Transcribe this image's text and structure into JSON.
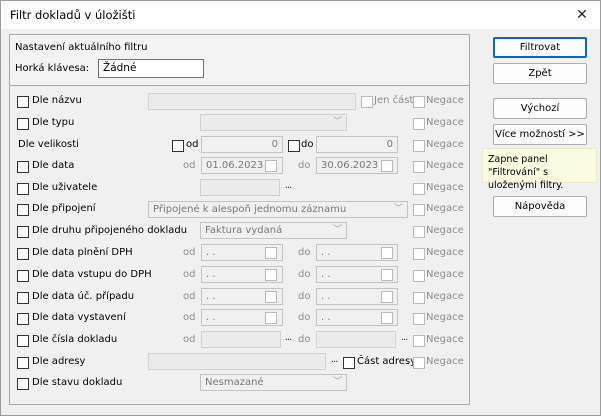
{
  "window": {
    "title": "Filtr dokladů v úložišti",
    "close_label": "✕"
  },
  "panel": {
    "heading": "Nastavení aktuálního filtru",
    "hotkey_label": "Horká klávesa:",
    "hotkey_value": "Žádné"
  },
  "common": {
    "negace": "Negace",
    "od": "od",
    "do": "do",
    "dots": "...",
    "combo_arrow": "﹀"
  },
  "rows": {
    "nazev": {
      "label": "Dle názvu",
      "jen_cast": "Jen část"
    },
    "typ": {
      "label": "Dle typu"
    },
    "velikost": {
      "label": "Dle velikosti",
      "od_value": "0",
      "do_value": "0"
    },
    "data": {
      "label": "Dle data",
      "od_value": "01.06.2023",
      "do_value": "30.06.2023"
    },
    "uzivatel": {
      "label": "Dle uživatele"
    },
    "pripojeni": {
      "label": "Dle připojení",
      "value": "Připojené k alespoň jednomu záznamu"
    },
    "druh": {
      "label": "Dle druhu připojeného dokladu",
      "value": "Faktura vydaná"
    },
    "plneni_dph": {
      "label": "Dle data plnění DPH",
      "empty_date": ". ."
    },
    "vstup_dph": {
      "label": "Dle data vstupu do DPH",
      "empty_date": ". ."
    },
    "uc_pripad": {
      "label": "Dle data úč. případu",
      "empty_date": ". ."
    },
    "vystaveni": {
      "label": "Dle data vystavení",
      "empty_date": ". ."
    },
    "cislo": {
      "label": "Dle čísla dokladu"
    },
    "adresa": {
      "label": "Dle adresy",
      "cast_adresy": "Část adresy"
    },
    "stav": {
      "label": "Dle stavu dokladu",
      "value": "Nesmazané"
    }
  },
  "buttons": {
    "filtrovat": "Filtrovat",
    "zpet": "Zpět",
    "vychozi": "Výchozí",
    "vice_moznosti": "Více možností >>",
    "napoveda": "Nápověda"
  },
  "tooltip": "Zapne panel \"Filtrování\" s uloženými filtry."
}
